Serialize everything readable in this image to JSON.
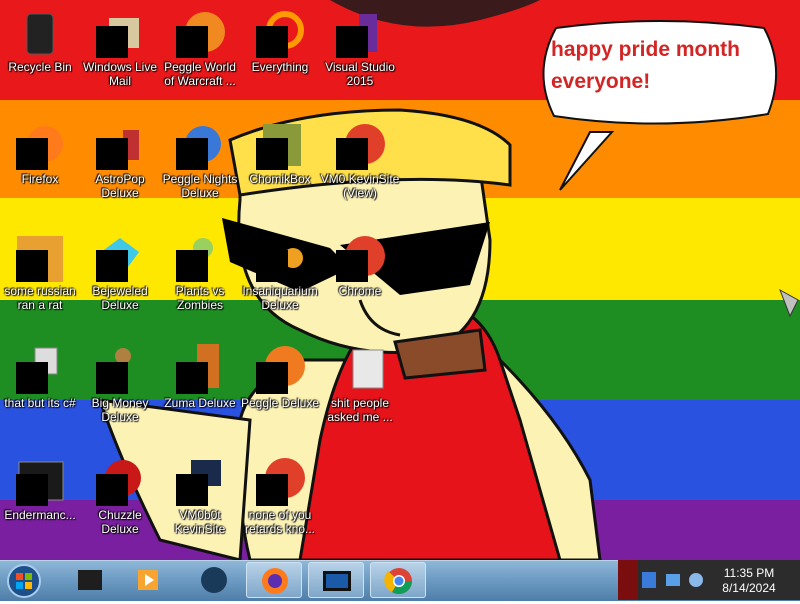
{
  "speech_bubble": {
    "line1": "happy pride month",
    "line2": "everyone!"
  },
  "colors": {
    "stripe_red": "#e9181a",
    "stripe_orange": "#ff8c00",
    "stripe_yellow": "#ffe800",
    "stripe_green": "#1e8e22",
    "stripe_blue": "#2a52e0",
    "stripe_purple": "#7a1fa0",
    "speech_text": "#d22626",
    "taskbar": "#6e9cc4"
  },
  "desktop_icons": [
    {
      "label": "Recycle Bin",
      "icon": "recycle-bin-icon"
    },
    {
      "label": "Windows Live Mail",
      "icon": "mail-icon"
    },
    {
      "label": "Peggle World of Warcraft ...",
      "icon": "peggle-icon"
    },
    {
      "label": "Everything",
      "icon": "search-icon"
    },
    {
      "label": "Visual Studio 2015",
      "icon": "visual-studio-icon"
    },
    {
      "label": "Firefox",
      "icon": "firefox-icon"
    },
    {
      "label": "AstroPop Deluxe",
      "icon": "astropop-icon"
    },
    {
      "label": "Peggle Nights Deluxe",
      "icon": "peggle-icon"
    },
    {
      "label": "ChomikBox",
      "icon": "chomikbox-icon"
    },
    {
      "label": "VM0 KevinSite (View)",
      "icon": "chrome-icon"
    },
    {
      "label": "some russian ran a rat",
      "icon": "folder-icon"
    },
    {
      "label": "Bejeweled Deluxe",
      "icon": "gem-icon"
    },
    {
      "label": "Plants vs Zombies",
      "icon": "plants-icon"
    },
    {
      "label": "Insaniquarium Deluxe",
      "icon": "fish-icon"
    },
    {
      "label": "Chrome",
      "icon": "chrome-icon"
    },
    {
      "label": "that but its c#",
      "icon": "copy-icon"
    },
    {
      "label": "Big Money Deluxe",
      "icon": "money-bag-icon"
    },
    {
      "label": "Zuma Deluxe",
      "icon": "zuma-icon"
    },
    {
      "label": "Peggle Deluxe",
      "icon": "peggle-icon"
    },
    {
      "label": "shit people asked me ...",
      "icon": "folder-icon"
    },
    {
      "label": "Endermanc...",
      "icon": "terminal-icon"
    },
    {
      "label": "Chuzzle Deluxe",
      "icon": "chuzzle-icon"
    },
    {
      "label": "VM0b0t KevinSite",
      "icon": "vm-icon"
    },
    {
      "label": "none of you retards kno...",
      "icon": "chrome-icon"
    }
  ],
  "taskbar": {
    "pinned": [
      {
        "name": "start-orb",
        "icon": "windows-icon"
      },
      {
        "name": "explorer",
        "icon": "folder-icon"
      },
      {
        "name": "media-player",
        "icon": "play-icon"
      },
      {
        "name": "app-globe",
        "icon": "globe-icon"
      },
      {
        "name": "firefox",
        "icon": "firefox-icon"
      },
      {
        "name": "monitor",
        "icon": "monitor-icon"
      },
      {
        "name": "chrome",
        "icon": "chrome-icon"
      }
    ],
    "clock": {
      "time": "11:35 PM",
      "date": "8/14/2024"
    }
  }
}
